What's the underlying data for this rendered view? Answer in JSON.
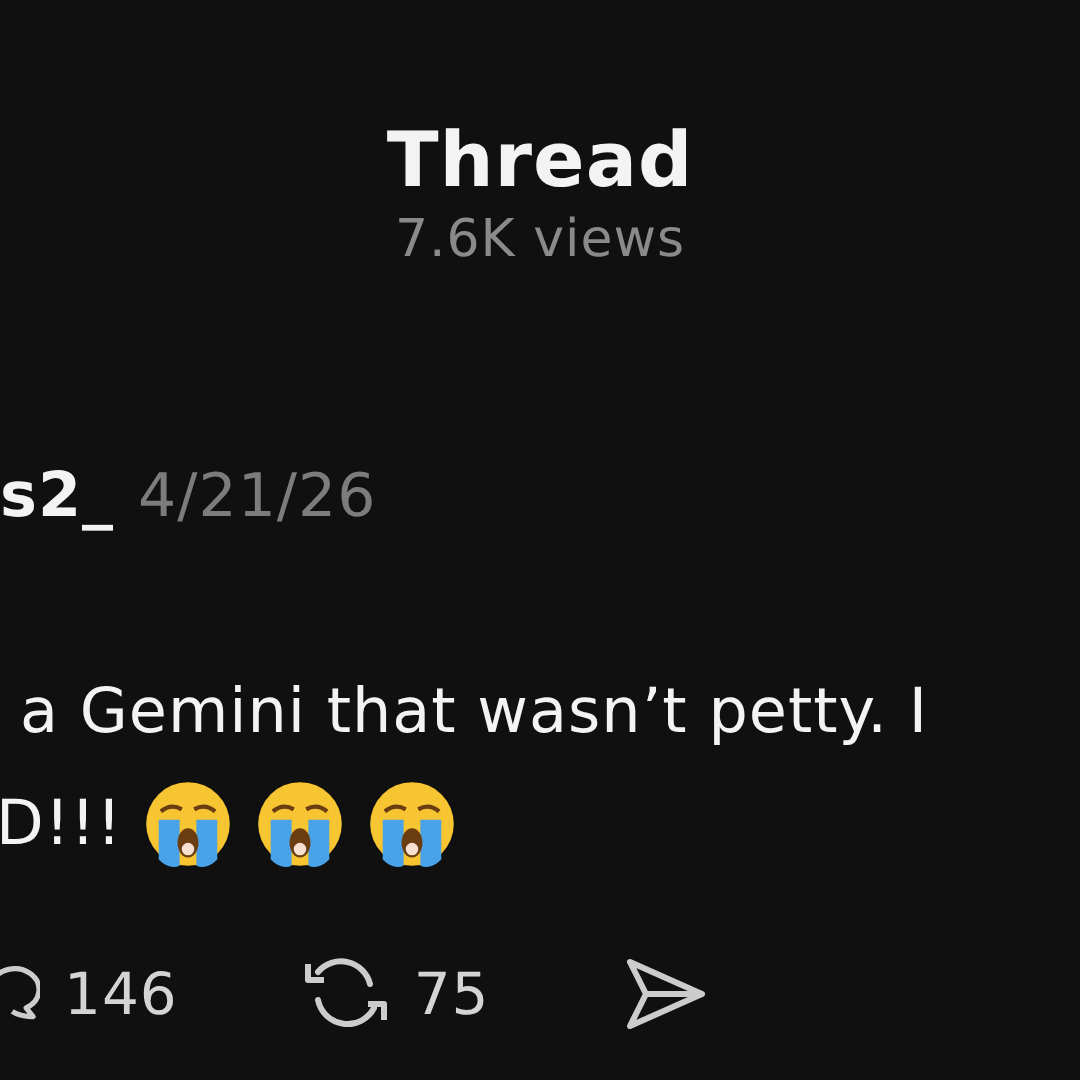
{
  "header": {
    "title": "Thread",
    "views": "7.6K views"
  },
  "post": {
    "username": "s2_",
    "date": "4/21/26",
    "lines": [
      {
        "text": "a Gemini that wasn’t petty. I"
      },
      {
        "text": "D!!!",
        "icons": [
          {
            "kind": "crying-face"
          },
          {
            "kind": "crying-face"
          },
          {
            "kind": "crying-face"
          }
        ]
      }
    ],
    "actions": [
      {
        "kind": "reply",
        "count": "146"
      },
      {
        "kind": "repost",
        "count": "75"
      },
      {
        "kind": "share"
      }
    ]
  }
}
